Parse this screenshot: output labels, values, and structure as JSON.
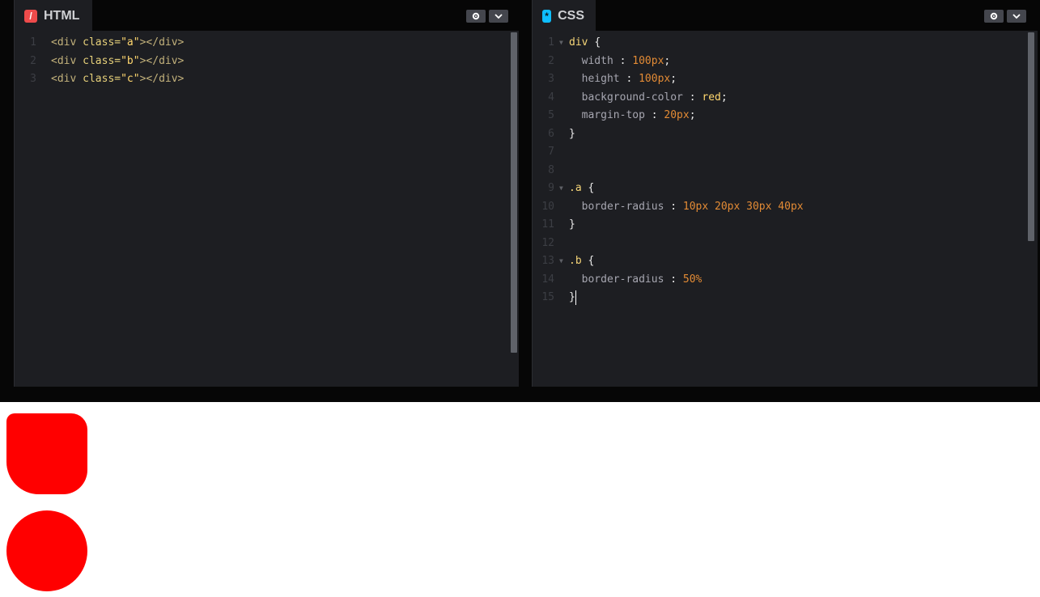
{
  "html_pane": {
    "tab_label": "HTML",
    "icon": "html-slash-icon",
    "lines": [
      {
        "num": "1",
        "tag_open": "<div ",
        "attr": "class=",
        "value": "\"a\"",
        "tag_close": "></div>"
      },
      {
        "num": "2",
        "tag_open": "<div ",
        "attr": "class=",
        "value": "\"b\"",
        "tag_close": "></div>"
      },
      {
        "num": "3",
        "tag_open": "<div ",
        "attr": "class=",
        "value": "\"c\"",
        "tag_close": "></div>"
      }
    ]
  },
  "css_pane": {
    "tab_label": "CSS",
    "icon": "css-asterisk-icon",
    "lines": [
      {
        "num": "1",
        "sel": "div ",
        "brace": "{"
      },
      {
        "num": "2",
        "prop": "width ",
        "colon": ": ",
        "val": "100px",
        "semi": ";"
      },
      {
        "num": "3",
        "prop": "height ",
        "colon": ": ",
        "val": "100px",
        "semi": ";"
      },
      {
        "num": "4",
        "prop": "background-color ",
        "colon": ": ",
        "val": "red",
        "semi": ";"
      },
      {
        "num": "5",
        "prop": "margin-top ",
        "colon": ": ",
        "val": "20px",
        "semi": ";"
      },
      {
        "num": "6",
        "brace": "}"
      },
      {
        "num": "7"
      },
      {
        "num": "8"
      },
      {
        "num": "9",
        "sel": ".a ",
        "brace": "{"
      },
      {
        "num": "10",
        "prop": "border-radius ",
        "colon": ": ",
        "val": "10px 20px 30px 40px"
      },
      {
        "num": "11",
        "brace": "}"
      },
      {
        "num": "12"
      },
      {
        "num": "13",
        "sel": ".b ",
        "brace": "{"
      },
      {
        "num": "14",
        "prop": "border-radius ",
        "colon": ": ",
        "val": "50%"
      },
      {
        "num": "15",
        "brace": "}"
      }
    ]
  },
  "controls": {
    "settings_icon": "gear-icon",
    "collapse_icon": "chevron-down-icon"
  },
  "colors": {
    "editor_bg": "#1d1e22",
    "chrome_bg": "#060606",
    "preview_box": "#ff0000"
  }
}
